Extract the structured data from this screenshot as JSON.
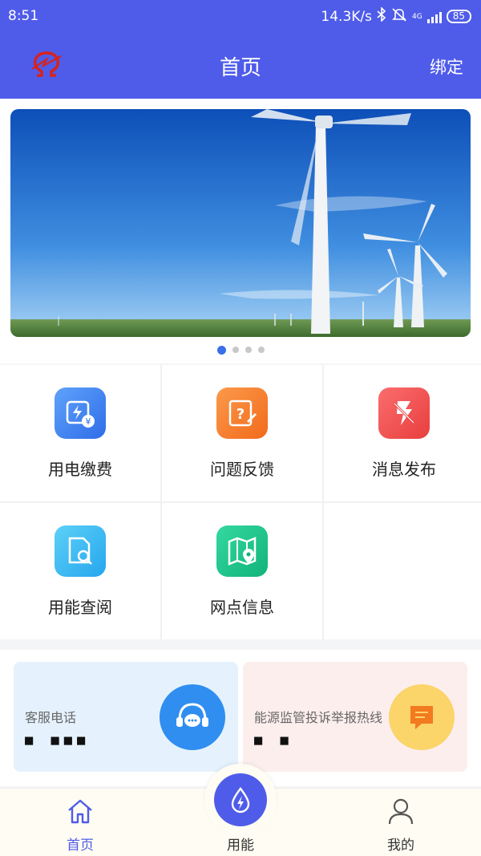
{
  "status_bar": {
    "time": "8:51",
    "speed": "14.3K/s",
    "network": "4G",
    "battery": "85"
  },
  "header": {
    "title": "首页",
    "bind_label": "绑定",
    "logo_icon": "omega-power-logo"
  },
  "banner": {
    "image": "wind-turbines-photo",
    "slide_count": 4,
    "active_slide": 1
  },
  "services": [
    {
      "label": "用电缴费",
      "icon": "electricity-payment-icon",
      "color": "#3b82f6"
    },
    {
      "label": "问题反馈",
      "icon": "feedback-icon",
      "color": "#f97316"
    },
    {
      "label": "消息发布",
      "icon": "message-publish-icon",
      "color": "#ef4444"
    },
    {
      "label": "用能查阅",
      "icon": "energy-query-icon",
      "color": "#38bdf8"
    },
    {
      "label": "网点信息",
      "icon": "outlet-map-icon",
      "color": "#10b981"
    }
  ],
  "contacts": {
    "service": {
      "title": "客服电话",
      "number": "■ ■■■",
      "icon": "headset-chat-icon"
    },
    "hotline": {
      "title": "能源监管投诉举报热线",
      "number": "■ ■",
      "icon": "message-icon"
    }
  },
  "tabbar": {
    "home": "首页",
    "energy": "用能",
    "mine": "我的"
  }
}
